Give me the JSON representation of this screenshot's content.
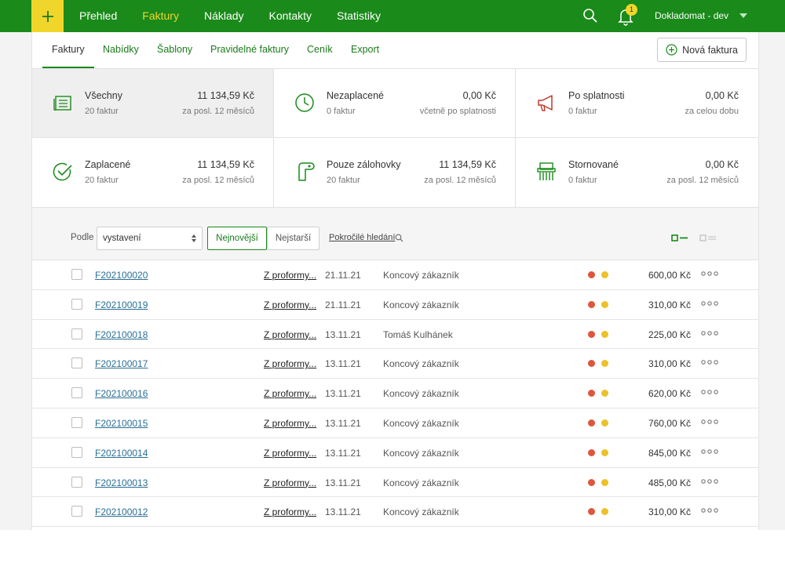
{
  "topnav": {
    "items": [
      {
        "label": "Přehled",
        "active": false
      },
      {
        "label": "Faktury",
        "active": true
      },
      {
        "label": "Náklady",
        "active": false
      },
      {
        "label": "Kontakty",
        "active": false
      },
      {
        "label": "Statistiky",
        "active": false
      }
    ],
    "notifications_count": "1",
    "account_name": "Dokladomat - dev",
    "colors": {
      "bar": "#1a8a1a",
      "accent": "#f0d62a"
    }
  },
  "subtabs": {
    "items": [
      "Faktury",
      "Nabídky",
      "Šablony",
      "Pravidelné faktury",
      "Ceník",
      "Export"
    ],
    "active": "Faktury",
    "new_invoice_label": "Nová faktura"
  },
  "summary": [
    {
      "name": "Všechny",
      "count": "20 faktur",
      "amount": "11 134,59 Kč",
      "period": "za posl. 12 měsíců",
      "icon": "document-list-icon",
      "active": true
    },
    {
      "name": "Nezaplacené",
      "count": "0 faktur",
      "amount": "0,00 Kč",
      "period": "včetně po splatnosti",
      "icon": "clock-icon",
      "active": false
    },
    {
      "name": "Po splatnosti",
      "count": "0 faktur",
      "amount": "0,00 Kč",
      "period": "za celou dobu",
      "icon": "megaphone-icon",
      "active": false
    },
    {
      "name": "Zaplacené",
      "count": "20 faktur",
      "amount": "11 134,59 Kč",
      "period": "za posl. 12 měsíců",
      "icon": "check-circle-icon",
      "active": false
    },
    {
      "name": "Pouze zálohovky",
      "count": "20 faktur",
      "amount": "11 134,59 Kč",
      "period": "za posl. 12 měsíců",
      "icon": "receipt-roll-icon",
      "active": false
    },
    {
      "name": "Stornované",
      "count": "0 faktur",
      "amount": "0,00 Kč",
      "period": "za posl. 12 měsíců",
      "icon": "shredder-icon",
      "active": false
    }
  ],
  "filters": {
    "sort_label": "Podle",
    "sort_value": "vystavení",
    "newest_label": "Nejnovější",
    "oldest_label": "Nejstarší",
    "advanced_search_label": "Pokročilé hledání"
  },
  "status_colors": {
    "red": "#e0553b",
    "yellow": "#ecc12a"
  },
  "invoices": [
    {
      "number": "F202100020",
      "source": "Z proformy...",
      "date": "21.11.21",
      "customer": "Koncový zákazník",
      "amount": "600,00 Kč"
    },
    {
      "number": "F202100019",
      "source": "Z proformy...",
      "date": "21.11.21",
      "customer": "Koncový zákazník",
      "amount": "310,00 Kč"
    },
    {
      "number": "F202100018",
      "source": "Z proformy...",
      "date": "13.11.21",
      "customer": "Tomáš Kulhánek",
      "amount": "225,00 Kč"
    },
    {
      "number": "F202100017",
      "source": "Z proformy...",
      "date": "13.11.21",
      "customer": "Koncový zákazník",
      "amount": "310,00 Kč"
    },
    {
      "number": "F202100016",
      "source": "Z proformy...",
      "date": "13.11.21",
      "customer": "Koncový zákazník",
      "amount": "620,00 Kč"
    },
    {
      "number": "F202100015",
      "source": "Z proformy...",
      "date": "13.11.21",
      "customer": "Koncový zákazník",
      "amount": "760,00 Kč"
    },
    {
      "number": "F202100014",
      "source": "Z proformy...",
      "date": "13.11.21",
      "customer": "Koncový zákazník",
      "amount": "845,00 Kč"
    },
    {
      "number": "F202100013",
      "source": "Z proformy...",
      "date": "13.11.21",
      "customer": "Koncový zákazník",
      "amount": "485,00 Kč"
    },
    {
      "number": "F202100012",
      "source": "Z proformy...",
      "date": "13.11.21",
      "customer": "Koncový zákazník",
      "amount": "310,00 Kč"
    }
  ]
}
